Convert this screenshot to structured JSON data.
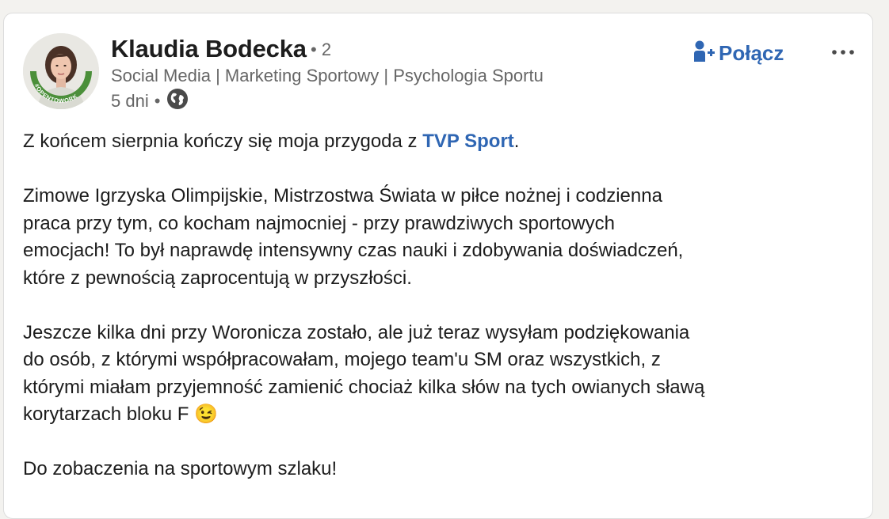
{
  "post": {
    "author": {
      "name": "Klaudia Bodecka",
      "degree": "• 2",
      "headline": "Social Media | Marketing Sportowy | Psychologia Sportu",
      "avatar_badge": "#OPENTOWORK"
    },
    "meta": {
      "time": "5 dni",
      "separator": "•",
      "visibility_icon": "globe-icon"
    },
    "actions": {
      "connect_label": "Połącz",
      "connect_icon": "person-add-icon",
      "more_icon": "more-horizontal-icon"
    },
    "body": {
      "p1_before": "Z końcem sierpnia kończy się moja przygoda z ",
      "p1_mention": "TVP Sport",
      "p1_after": ".",
      "p2_l1": "Zimowe Igrzyska Olimpijskie, Mistrzostwa Świata w piłce nożnej i codzienna",
      "p2_l2": "praca przy tym, co kocham najmocniej - przy prawdziwych sportowych",
      "p2_l3": "emocjach! To był naprawdę intensywny czas nauki i zdobywania doświadczeń,",
      "p2_l4": "które z pewnością zaprocentują w przyszłości.",
      "p3_l1": "Jeszcze kilka dni przy Woronicza zostało, ale już teraz wysyłam podziękowania",
      "p3_l2": "do osób, z którymi współpracowałam, mojego team'u SM oraz wszystkich, z",
      "p3_l3": "którymi miałam przyjemność zamienić chociaż kilka słów na tych owianych sławą",
      "p3_l4": "korytarzach bloku F ",
      "p3_emoji": "😉",
      "p4": "Do zobaczenia na sportowym szlaku!"
    },
    "colors": {
      "link_blue": "#2f66b3",
      "open_to_work_green": "#4b8f3a",
      "text": "#1d1d1d",
      "secondary_text": "#666666"
    }
  }
}
